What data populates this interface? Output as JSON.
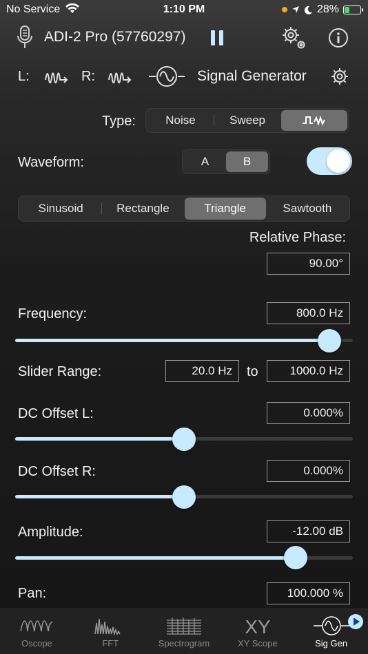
{
  "status": {
    "carrier": "No Service",
    "time": "1:10 PM",
    "battery": "28%"
  },
  "header": {
    "device": "ADI-2 Pro (57760297)"
  },
  "channels": {
    "left": "L:",
    "right": "R:",
    "title": "Signal Generator"
  },
  "type_control": {
    "label": "Type:",
    "options": [
      "Noise",
      "Sweep"
    ],
    "selected_icon": "square-wave-icon"
  },
  "waveform_control": {
    "label": "Waveform:",
    "options": [
      "A",
      "B"
    ],
    "selected": "B",
    "toggle_on": true
  },
  "shape_control": {
    "options": [
      "Sinusoid",
      "Rectangle",
      "Triangle",
      "Sawtooth"
    ],
    "selected": "Triangle"
  },
  "relative_phase": {
    "label": "Relative Phase:",
    "value": "90.00°"
  },
  "frequency": {
    "label": "Frequency:",
    "value": "800.0 Hz",
    "level": 0.93
  },
  "slider_range": {
    "label": "Slider Range:",
    "from": "20.0 Hz",
    "to_label": "to",
    "to": "1000.0 Hz"
  },
  "dc_offset_l": {
    "label": "DC Offset L:",
    "value": "0.000%",
    "level": 0.5
  },
  "dc_offset_r": {
    "label": "DC Offset R:",
    "value": "0.000%",
    "level": 0.5
  },
  "amplitude": {
    "label": "Amplitude:",
    "value": "-12.00 dB",
    "level": 0.83
  },
  "pan": {
    "label": "Pan:",
    "value": "100.000 %"
  },
  "tabs": [
    "Oscope",
    "FFT",
    "Spectrogram",
    "XY Scope",
    "Sig Gen"
  ],
  "active_tab": "Sig Gen",
  "colors": {
    "accent": "#c8eaff",
    "background": "#1c1c1c"
  }
}
